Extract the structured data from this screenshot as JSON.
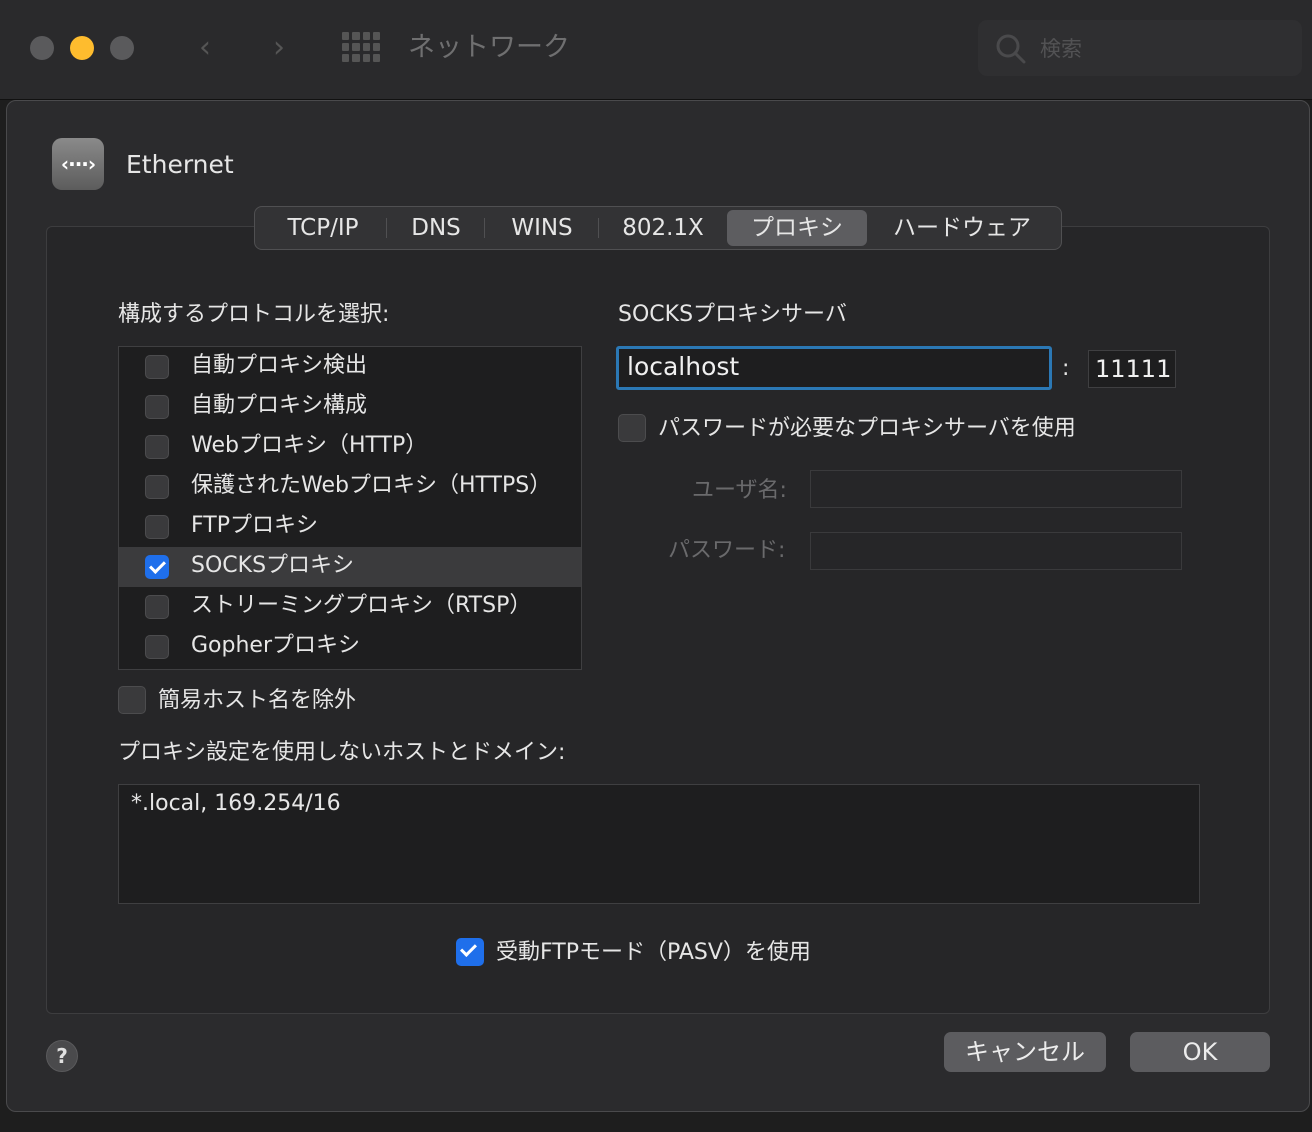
{
  "window": {
    "title": "ネットワーク",
    "back_icon": "chevron-left",
    "forward_icon": "chevron-right",
    "search_placeholder": "検索"
  },
  "interface": {
    "name": "Ethernet",
    "icon_glyph": "‹···›"
  },
  "tabs": [
    {
      "label": "TCP/IP",
      "active": false
    },
    {
      "label": "DNS",
      "active": false
    },
    {
      "label": "WINS",
      "active": false
    },
    {
      "label": "802.1X",
      "active": false
    },
    {
      "label": "プロキシ",
      "active": true
    },
    {
      "label": "ハードウェア",
      "active": false
    }
  ],
  "protocols": {
    "heading": "構成するプロトコルを選択:",
    "items": [
      {
        "label": "自動プロキシ検出",
        "checked": false
      },
      {
        "label": "自動プロキシ構成",
        "checked": false
      },
      {
        "label": "Webプロキシ（HTTP）",
        "checked": false
      },
      {
        "label": "保護されたWebプロキシ（HTTPS）",
        "checked": false
      },
      {
        "label": "FTPプロキシ",
        "checked": false
      },
      {
        "label": "SOCKSプロキシ",
        "checked": true
      },
      {
        "label": "ストリーミングプロキシ（RTSP）",
        "checked": false
      },
      {
        "label": "Gopherプロキシ",
        "checked": false
      }
    ]
  },
  "server": {
    "heading": "SOCKSプロキシサーバ",
    "host": "localhost",
    "separator": ":",
    "port": "11111",
    "password_required_label": "パスワードが必要なプロキシサーバを使用",
    "password_required": false,
    "username_label": "ユーザ名:",
    "password_label": "パスワード:"
  },
  "exclude_simple_label": "簡易ホスト名を除外",
  "bypass": {
    "label": "プロキシ設定を使用しないホストとドメイン:",
    "value": "*.local, 169.254/16"
  },
  "passive_ftp_label": "受動FTPモード（PASV）を使用",
  "buttons": {
    "help": "?",
    "cancel": "キャンセル",
    "ok": "OK"
  },
  "colors": {
    "accent": "#1f6feb",
    "focus_ring": "#2b78b5",
    "close": "#5a5a5c",
    "minimize": "#febc2e",
    "zoom": "#5a5a5c"
  }
}
